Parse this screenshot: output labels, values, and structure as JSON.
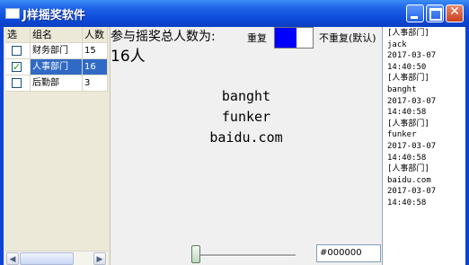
{
  "window": {
    "title": "J样摇奖软件"
  },
  "groups": {
    "headers": [
      "选",
      "组名",
      "人数"
    ],
    "rows": [
      {
        "checked": false,
        "name": "财务部门",
        "count": "15",
        "selected": false
      },
      {
        "checked": true,
        "name": "人事部门",
        "count": "16",
        "selected": true
      },
      {
        "checked": false,
        "name": "后勤部",
        "count": "3",
        "selected": false
      }
    ]
  },
  "summary": {
    "label": "参与摇奖总人数为:",
    "value": "16人"
  },
  "options": {
    "repeat_label": "重复",
    "norepeat_label": "不重复(默认)",
    "swatch_color": "#0000ff"
  },
  "winners": [
    "banght",
    "funker",
    "baidu.com"
  ],
  "color_field": {
    "value": "#000000"
  },
  "log": [
    "[人事部门]",
    "jack",
    "2017-03-07",
    "14:40:50",
    "[人事部门]",
    "banght",
    "2017-03-07",
    "14:40:58",
    "[人事部门]",
    "funker",
    "2017-03-07",
    "14:40:58",
    "[人事部门]",
    "baidu.com",
    "2017-03-07",
    "14:40:58"
  ]
}
